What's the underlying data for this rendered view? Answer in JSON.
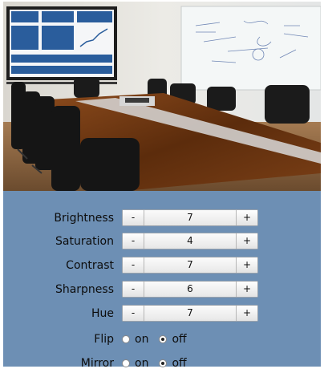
{
  "photo": {
    "alt": "conference room"
  },
  "controls": [
    {
      "key": "brightness",
      "label": "Brightness",
      "value": "7",
      "minus": "-",
      "plus": "+"
    },
    {
      "key": "saturation",
      "label": "Saturation",
      "value": "4",
      "minus": "-",
      "plus": "+"
    },
    {
      "key": "contrast",
      "label": "Contrast",
      "value": "7",
      "minus": "-",
      "plus": "+"
    },
    {
      "key": "sharpness",
      "label": "Sharpness",
      "value": "6",
      "minus": "-",
      "plus": "+"
    },
    {
      "key": "hue",
      "label": "Hue",
      "value": "7",
      "minus": "-",
      "plus": "+"
    }
  ],
  "flip": {
    "label": "Flip",
    "on_label": "on",
    "off_label": "off",
    "selected": "off"
  },
  "mirror": {
    "label": "Mirror",
    "on_label": "on",
    "off_label": "off",
    "selected": "off"
  },
  "colors": {
    "panel": "#6d8fb4",
    "table": "#6a3510",
    "wall": "#e9e6de"
  }
}
